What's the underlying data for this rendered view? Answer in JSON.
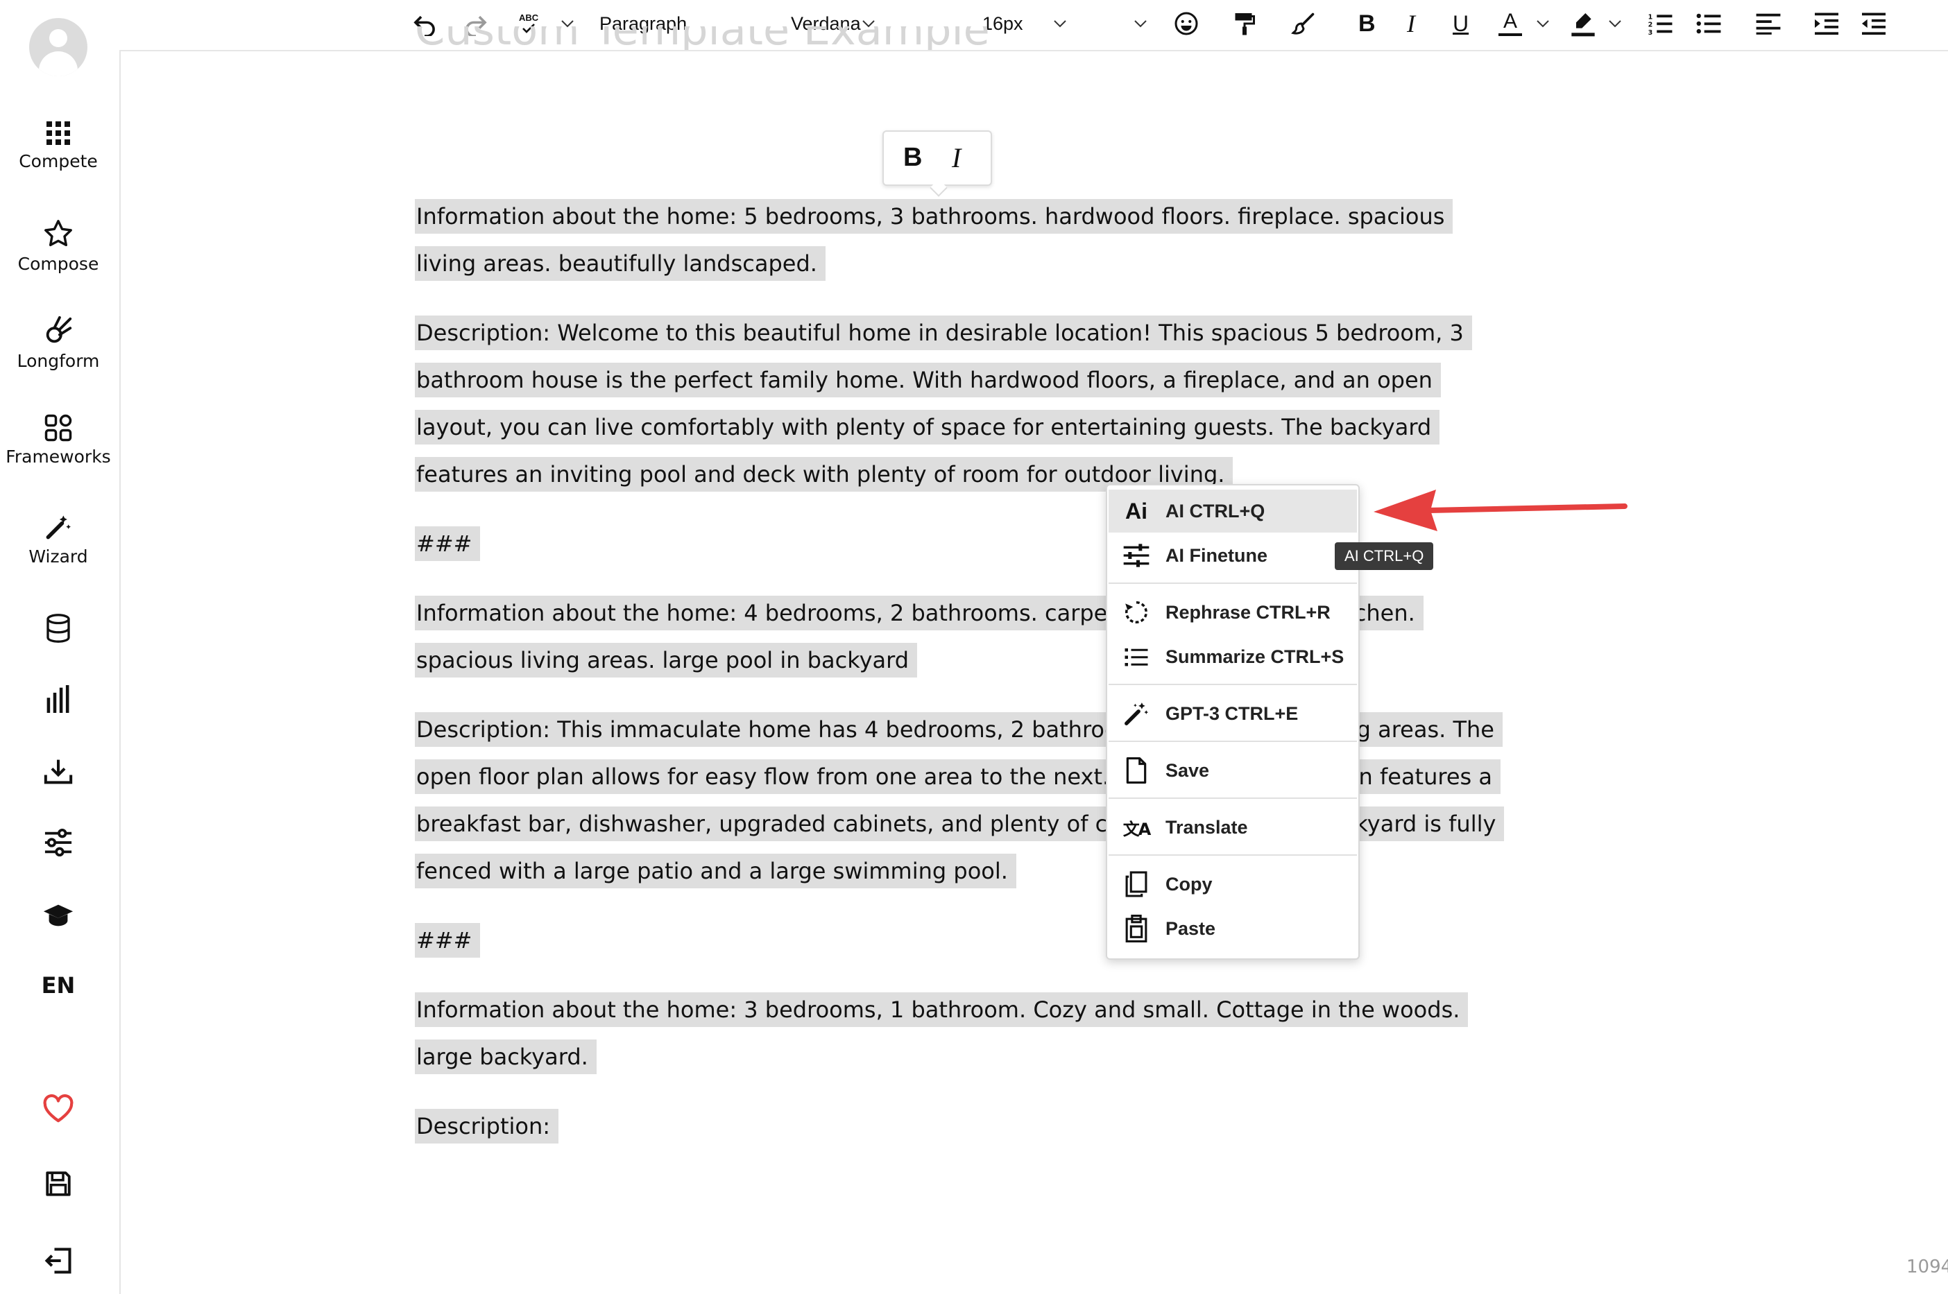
{
  "sidebar": {
    "items": [
      {
        "label": "Compete",
        "icon": "grid-icon"
      },
      {
        "label": "Compose",
        "icon": "star-icon"
      },
      {
        "label": "Longform",
        "icon": "comet-icon"
      },
      {
        "label": "Frameworks",
        "icon": "frameworks-icon"
      },
      {
        "label": "Wizard",
        "icon": "magic-wand-icon"
      }
    ],
    "language": "EN"
  },
  "toolbar": {
    "block_format": "Paragraph",
    "font_family": "Verdana",
    "font_size": "16px",
    "spellcheck_glyph": "ABC",
    "bold_glyph": "B",
    "italic_glyph": "I",
    "underline_glyph": "U",
    "text_color_glyph": "A"
  },
  "document": {
    "title": "Custom Template Example",
    "paragraphs": [
      "Information about the home: 5 bedrooms, 3 bathrooms. hardwood floors. fireplace. spacious living areas. beautifully landscaped.",
      "Description: Welcome to this beautiful home in desirable location! This spacious 5 bedroom, 3 bathroom house is the perfect family home. With hardwood floors, a fireplace, and an open layout, you can live comfortably with plenty of space for entertaining guests. The backyard features an inviting pool and deck with plenty of room for outdoor living.",
      "###",
      "Information about the home: 4 bedrooms, 2 bathrooms. carpeted floors. updated kitchen. spacious living areas. large pool in backyard",
      "Description: This immaculate home has 4 bedrooms, 2 bathrooms and spacious living areas. The open floor plan allows for easy flow from one area to the next. The remodeled kitchen features a breakfast bar, dishwasher, upgraded cabinets, and plenty of counter space. The backyard is fully fenced with a large patio and a large swimming pool.",
      "###",
      "Information about the home: 3 bedrooms, 1 bathroom. Cozy and small. Cottage in the woods. large backyard.",
      "Description:"
    ]
  },
  "bubble_toolbar": {
    "bold": "B",
    "italic": "I"
  },
  "context_menu": {
    "items": [
      {
        "label": "AI CTRL+Q",
        "icon": "ai-icon"
      },
      {
        "label": "AI Finetune",
        "icon": "sliders-icon"
      },
      {
        "label": "Rephrase CTRL+R",
        "icon": "rotate-icon"
      },
      {
        "label": "Summarize CTRL+S",
        "icon": "list-icon"
      },
      {
        "label": "GPT-3 CTRL+E",
        "icon": "magic-wand-icon"
      },
      {
        "label": "Save",
        "icon": "file-icon"
      },
      {
        "label": "Translate",
        "icon": "translate-icon"
      },
      {
        "label": "Copy",
        "icon": "copy-icon"
      },
      {
        "label": "Paste",
        "icon": "paste-icon"
      }
    ],
    "ai_glyph": "Ai",
    "translate_glyph": "文A"
  },
  "tooltip": "AI CTRL+Q",
  "page_number": "1094",
  "colors": {
    "highlight": "#dedede",
    "annotation_arrow": "#e5403f",
    "heart": "#e5403f"
  }
}
